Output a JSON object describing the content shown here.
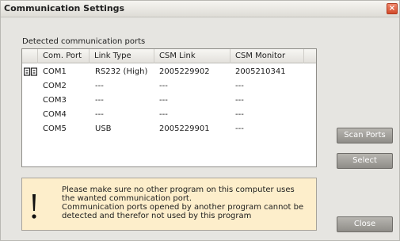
{
  "window": {
    "title": "Communication Settings",
    "close_glyph": "×"
  },
  "ports": {
    "section_label": "Detected communication ports",
    "columns": [
      "Com. Port",
      "Link Type",
      "CSM Link",
      "CSM Monitor"
    ],
    "rows": [
      {
        "port": "COM1",
        "link_type": "RS232 (High)",
        "csm_link": "2005229902",
        "csm_monitor": "2005210341",
        "icon": "serial-port-icon"
      },
      {
        "port": "COM2",
        "link_type": "---",
        "csm_link": "---",
        "csm_monitor": "---"
      },
      {
        "port": "COM3",
        "link_type": "---",
        "csm_link": "---",
        "csm_monitor": "---"
      },
      {
        "port": "COM4",
        "link_type": "---",
        "csm_link": "---",
        "csm_monitor": "---"
      },
      {
        "port": "COM5",
        "link_type": "USB",
        "csm_link": "2005229901",
        "csm_monitor": "---"
      }
    ]
  },
  "buttons": {
    "scan_ports": "Scan Ports",
    "select": "Select",
    "close": "Close"
  },
  "notice": {
    "icon": "exclamation-icon",
    "lines": [
      "Please make sure no other program on this computer uses",
      "the wanted communication port.",
      "Communication ports opened by another program cannot be",
      "detected and therefor not used by this program"
    ]
  }
}
